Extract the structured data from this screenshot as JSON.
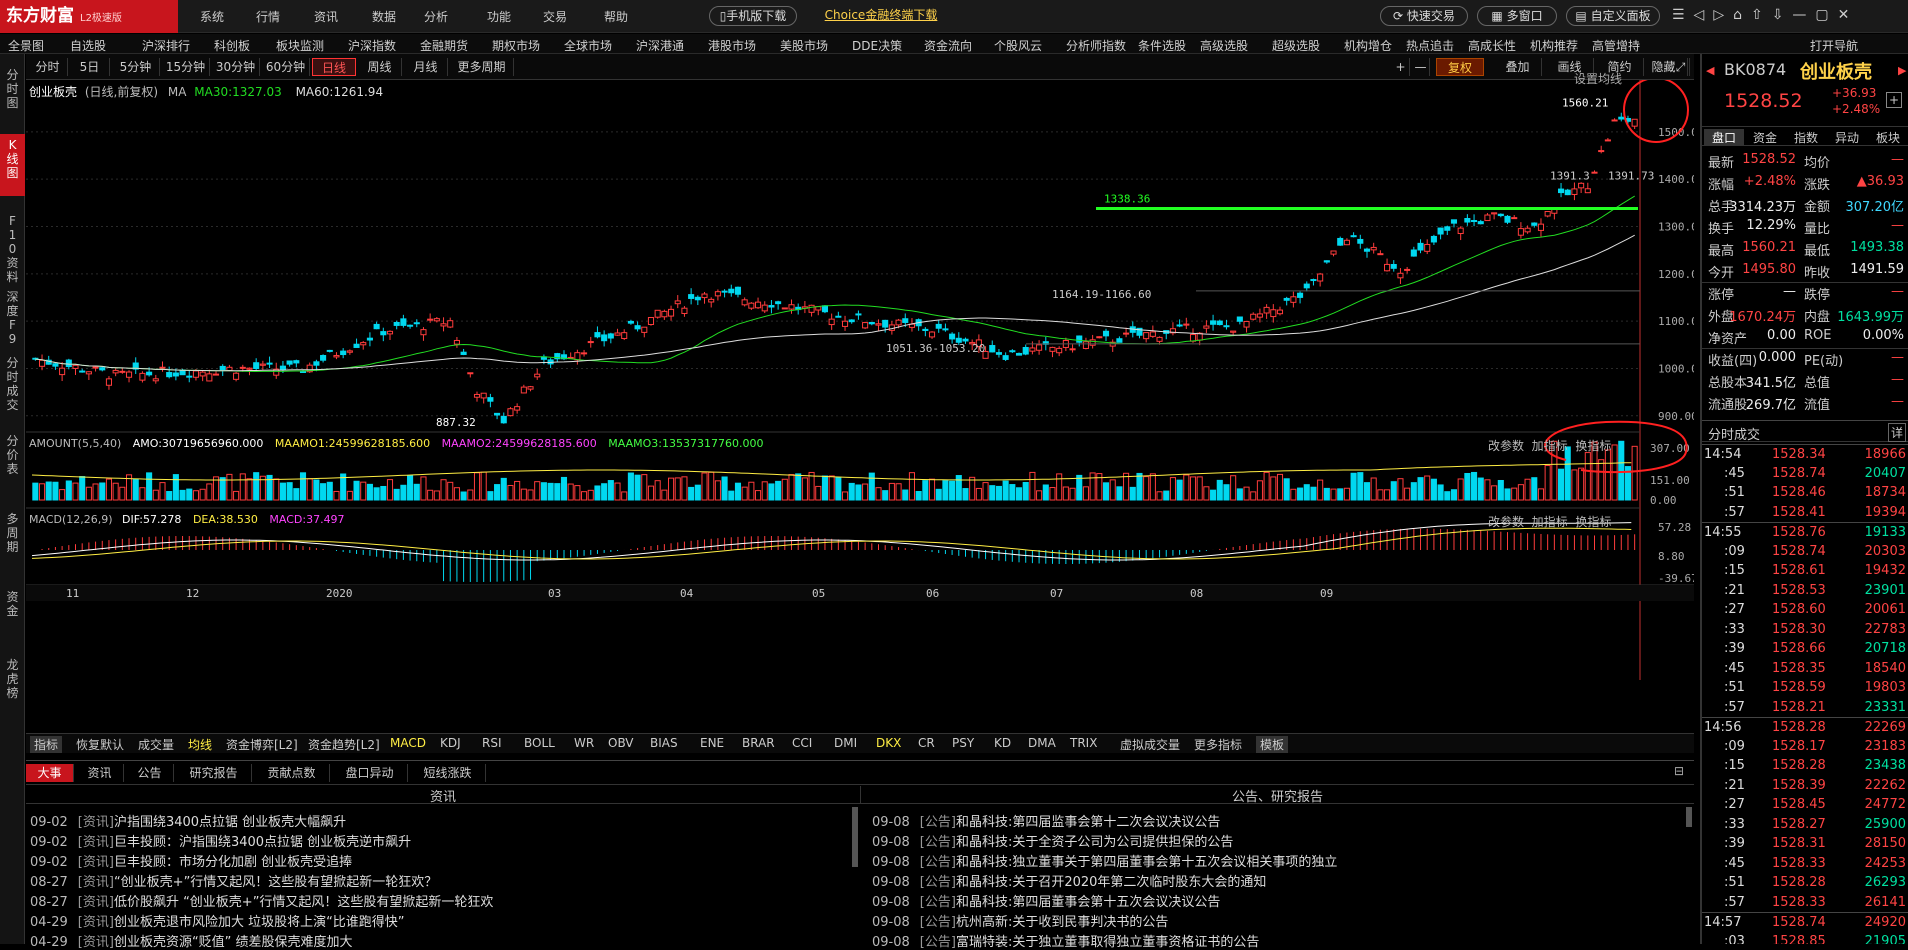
{
  "app": {
    "logo": "东方财富",
    "edition": "L2极速版"
  },
  "top_menu": [
    "系统",
    "行情",
    "资讯",
    "数据",
    "分析",
    "功能",
    "交易",
    "帮助"
  ],
  "top_buttons": {
    "mobile": "手机版下载",
    "choice": "Choice金融终端下载",
    "fast_trade": "快速交易",
    "multi_window": "多窗口",
    "custom": "自定义面板"
  },
  "nav": [
    "全景图",
    "自选股",
    "沪深排行",
    "科创板",
    "板块监测",
    "沪深指数",
    "金融期货",
    "期权市场",
    "全球市场",
    "沪深港通",
    "港股市场",
    "美股市场",
    "DDE决策",
    "资金流向",
    "个股风云",
    "分析师指数",
    "条件选股",
    "高级选股",
    "超级选股",
    "机构增仓",
    "热点追击",
    "高成长性",
    "机构推荐",
    "高管增持",
    "打开导航"
  ],
  "left_rail": [
    "分时图",
    "K线图",
    "F10资料",
    "深度F9",
    "分时成交",
    "分价表",
    "多周期",
    "资金",
    "龙虎榜"
  ],
  "toolbar": {
    "periods": [
      "分时",
      "5日",
      "5分钟",
      "15分钟",
      "30分钟",
      "60分钟",
      "日线",
      "周线",
      "月线",
      "更多周期"
    ],
    "active": "日线",
    "right": [
      "复权",
      "叠加",
      "画线",
      "简约",
      "隐藏"
    ]
  },
  "chart_header": {
    "name": "创业板壳",
    "mode": "(日线,前复权)",
    "ma_label": "MA",
    "ma30": "MA30:1327.03",
    "ma60": "MA60:1261.94",
    "settings": "设置均线"
  },
  "amount_header": {
    "label": "AMOUNT(5,5,40)",
    "amo": "AMO:30719656960.000",
    "m1": "MAAMO1:24599628185.600",
    "m2": "MAAMO2:24599628185.600",
    "m3": "MAAMO3:13537317760.000",
    "actions": [
      "改参数",
      "加指标",
      "换指标"
    ]
  },
  "macd_header": {
    "label": "MACD(12,26,9)",
    "dif": "DIF:57.278",
    "dea": "DEA:38.530",
    "macd": "MACD:37.497",
    "actions": [
      "改参数",
      "加指标",
      "换指标"
    ]
  },
  "chart_data": {
    "type": "candlestick",
    "y_axis": [
      "1500.00",
      "1400.00",
      "1300.00",
      "1200.00",
      "1100.00",
      "1000.00",
      "900.00"
    ],
    "amount_axis": [
      "307.00",
      "151.00",
      "0.00"
    ],
    "macd_axis": [
      "57.28",
      "8.80",
      "-39.67"
    ],
    "x_labels": [
      "11",
      "12",
      "2020",
      "03",
      "04",
      "05",
      "06",
      "07",
      "08",
      "09"
    ],
    "annotations": {
      "high": "1560.21",
      "low": "887.32",
      "level_1338": "1338.36",
      "range_1164": "1164.19-1166.60",
      "range_1051": "1051.36-1053.20",
      "range_1391": "1391.3",
      "range_1391b": "1391.73"
    },
    "ylim": [
      870,
      1580
    ]
  },
  "indicators": [
    "指标",
    "恢复默认",
    "成交量",
    "均线",
    "资金博弈[L2]",
    "资金趋势[L2]",
    "MACD",
    "KDJ",
    "RSI",
    "BOLL",
    "WR",
    "OBV",
    "BIAS",
    "ENE",
    "BRAR",
    "CCI",
    "DMI",
    "DKX",
    "CR",
    "PSY",
    "KD",
    "DMA",
    "TRIX",
    "虚拟成交量",
    "更多指标",
    "模板"
  ],
  "bottom_tabs": [
    "大事",
    "资讯",
    "公告",
    "研究报告",
    "贡献点数",
    "盘口异动",
    "短线涨跌"
  ],
  "news_header": "资讯",
  "notice_header": "公告、研究报告",
  "news": [
    {
      "d": "09-02",
      "t": "[资讯]",
      "s": "沪指围绕3400点拉锯 创业板壳大幅飙升"
    },
    {
      "d": "09-02",
      "t": "[资讯]",
      "s": "巨丰投顾：沪指围绕3400点拉锯 创业板壳逆市飙升"
    },
    {
      "d": "09-02",
      "t": "[资讯]",
      "s": "巨丰投顾：市场分化加剧 创业板壳受追捧"
    },
    {
      "d": "08-27",
      "t": "[资讯]",
      "s": "“创业板壳+”行情又起风！这些股有望掀起新一轮狂欢？"
    },
    {
      "d": "08-27",
      "t": "[资讯]",
      "s": "低价股飙升 “创业板壳+”行情又起风！这些股有望掀起新一轮狂欢"
    },
    {
      "d": "04-29",
      "t": "[资讯]",
      "s": "创业板壳退市风险加大 垃圾股将上演“比谁跑得快”"
    },
    {
      "d": "04-29",
      "t": "[资讯]",
      "s": "创业板壳资源“贬值” 绩差股保壳难度加大"
    }
  ],
  "notices": [
    {
      "d": "09-08",
      "t": "[公告]",
      "s": "和晶科技:第四届监事会第十二次会议决议公告"
    },
    {
      "d": "09-08",
      "t": "[公告]",
      "s": "和晶科技:关于全资子公司为公司提供担保的公告"
    },
    {
      "d": "09-08",
      "t": "[公告]",
      "s": "和晶科技:独立董事关于第四届董事会第十五次会议相关事项的独立"
    },
    {
      "d": "09-08",
      "t": "[公告]",
      "s": "和晶科技:关于召开2020年第二次临时股东大会的通知"
    },
    {
      "d": "09-08",
      "t": "[公告]",
      "s": "和晶科技:第四届董事会第十五次会议决议公告"
    },
    {
      "d": "09-08",
      "t": "[公告]",
      "s": "杭州高新:关于收到民事判决书的公告"
    },
    {
      "d": "09-08",
      "t": "[公告]",
      "s": "富瑞特装:关于独立董事取得独立董事资格证书的公告"
    }
  ],
  "quote": {
    "code": "BK0874",
    "name": "创业板壳",
    "price": "1528.52",
    "change": "+36.93",
    "pct": "+2.48%",
    "tabs": [
      "盘口",
      "资金",
      "指数",
      "异动",
      "板块"
    ],
    "rows": [
      [
        "最新",
        "1528.52",
        "均价",
        "—"
      ],
      [
        "涨幅",
        "+2.48%",
        "涨跌",
        "▲36.93"
      ],
      [
        "总手",
        "3314.23万",
        "金额",
        "307.20亿"
      ],
      [
        "换手",
        "12.29%",
        "量比",
        "—"
      ],
      [
        "最高",
        "1560.21",
        "最低",
        "1493.38"
      ],
      [
        "今开",
        "1495.80",
        "昨收",
        "1491.59"
      ],
      [
        "涨停",
        "—",
        "跌停",
        "—"
      ],
      [
        "外盘",
        "1670.24万",
        "内盘",
        "1643.99万"
      ],
      [
        "净资产",
        "0.00",
        "ROE",
        "0.00%"
      ],
      [
        "收益(四)",
        "0.000",
        "PE(动)",
        "—"
      ],
      [
        "总股本",
        "341.5亿",
        "总值",
        "—"
      ],
      [
        "流通股",
        "269.7亿",
        "流值",
        "—"
      ]
    ]
  },
  "ticks_header": "分时成交",
  "ticks_detail": "详",
  "ticks": [
    [
      "14:54",
      "1528.34",
      "18966"
    ],
    [
      ":45",
      "1528.74",
      "20407"
    ],
    [
      ":51",
      "1528.46",
      "18734"
    ],
    [
      ":57",
      "1528.41",
      "19394"
    ],
    [
      "14:55",
      "1528.76",
      "19133"
    ],
    [
      ":09",
      "1528.74",
      "20303"
    ],
    [
      ":15",
      "1528.61",
      "19432"
    ],
    [
      ":21",
      "1528.53",
      "23901"
    ],
    [
      ":27",
      "1528.60",
      "20061"
    ],
    [
      ":33",
      "1528.30",
      "22783"
    ],
    [
      ":39",
      "1528.66",
      "20718"
    ],
    [
      ":45",
      "1528.35",
      "18540"
    ],
    [
      ":51",
      "1528.59",
      "19803"
    ],
    [
      ":57",
      "1528.21",
      "23331"
    ],
    [
      "14:56",
      "1528.28",
      "22269"
    ],
    [
      ":09",
      "1528.17",
      "23183"
    ],
    [
      ":15",
      "1528.28",
      "23438"
    ],
    [
      ":21",
      "1528.39",
      "22262"
    ],
    [
      ":27",
      "1528.45",
      "24772"
    ],
    [
      ":33",
      "1528.27",
      "25900"
    ],
    [
      ":39",
      "1528.31",
      "28150"
    ],
    [
      ":45",
      "1528.33",
      "24253"
    ],
    [
      ":51",
      "1528.28",
      "26293"
    ],
    [
      ":57",
      "1528.33",
      "26141"
    ],
    [
      "14:57",
      "1528.74",
      "24920"
    ],
    [
      ":03",
      "1528.85",
      "21905"
    ]
  ]
}
